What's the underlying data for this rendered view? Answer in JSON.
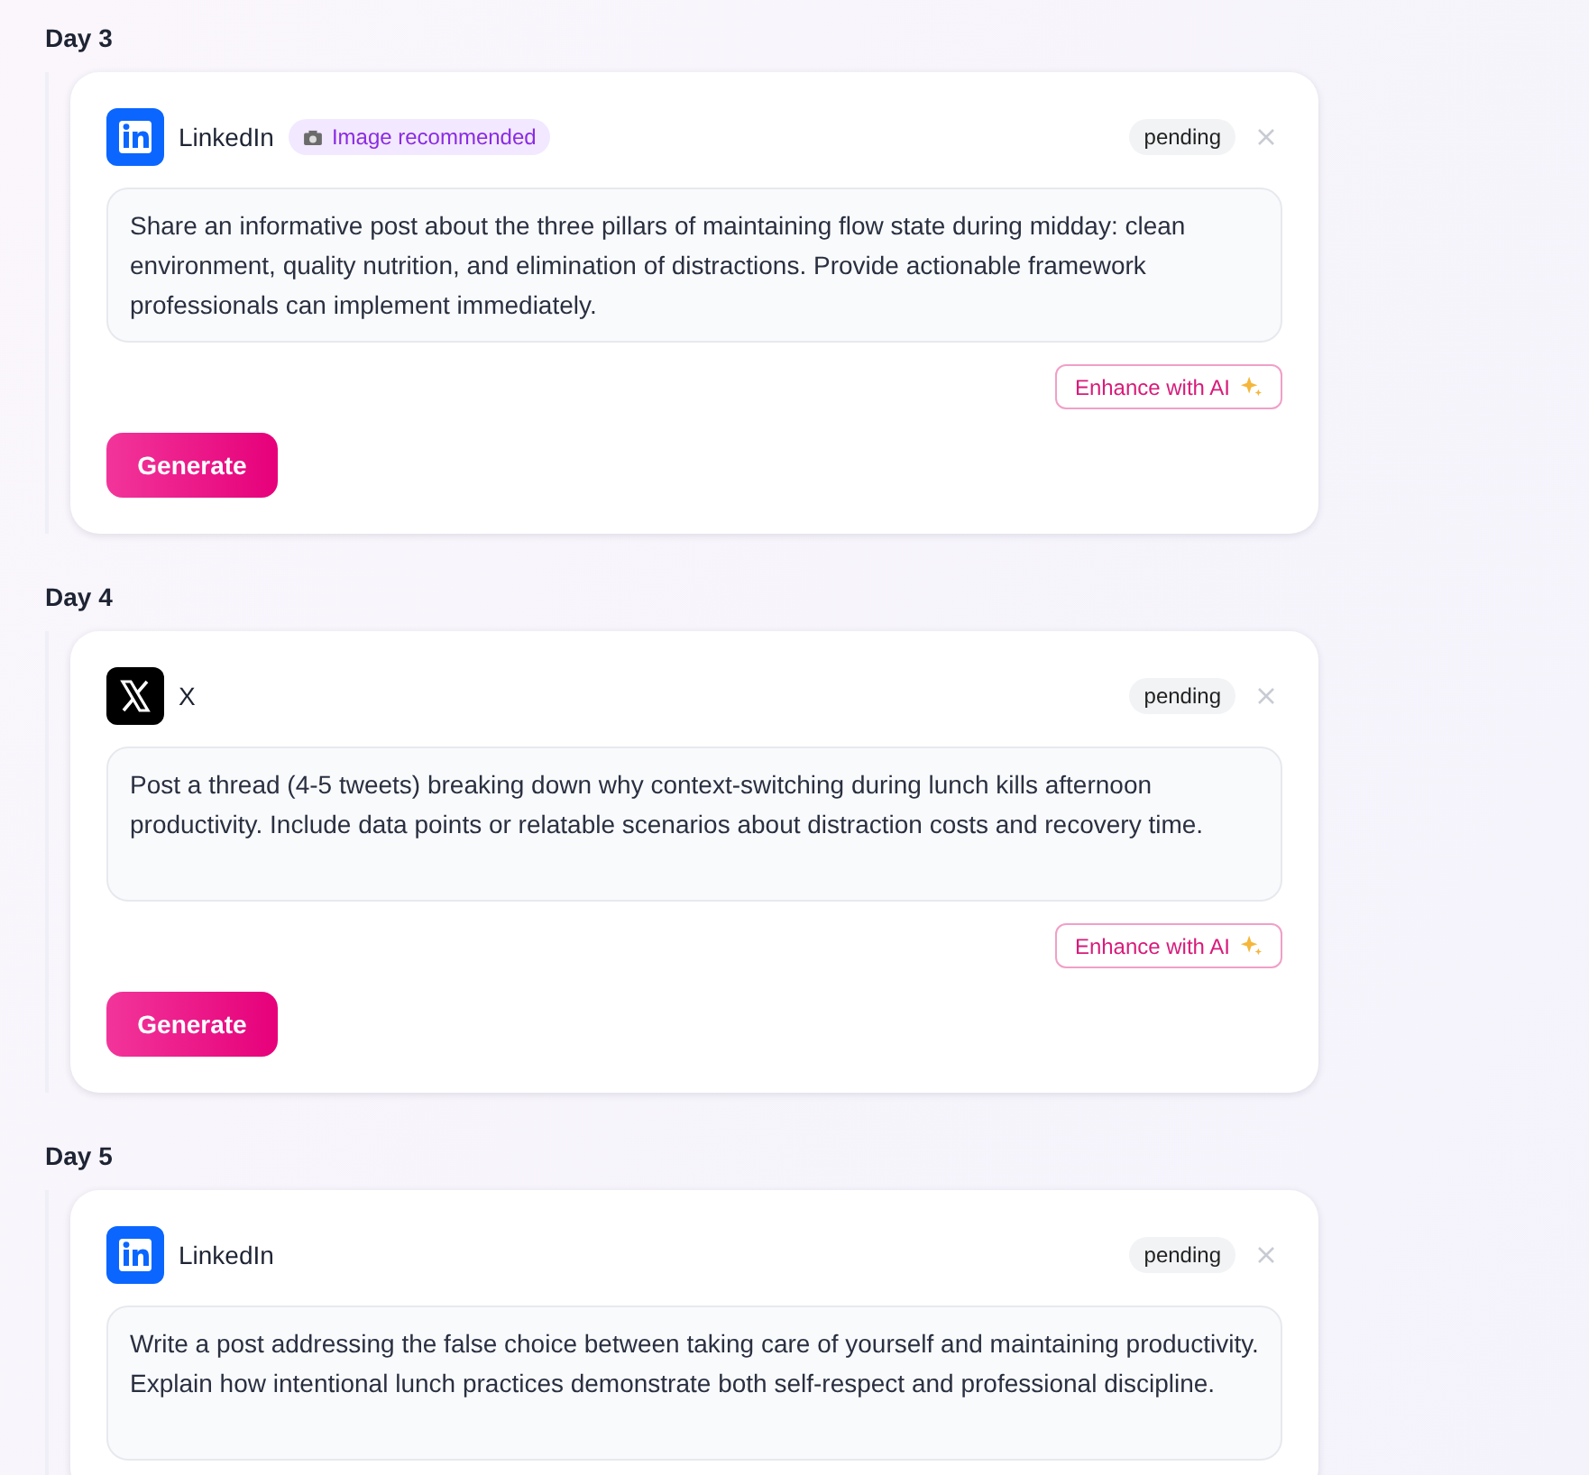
{
  "days": [
    {
      "label": "Day 3",
      "platform": {
        "kind": "linkedin",
        "name": "LinkedIn"
      },
      "badge": "Image recommended",
      "status": "pending",
      "prompt": "Share an informative post about the three pillars of maintaining flow state during midday: clean environment, quality nutrition, and elimination of distractions. Provide actionable framework professionals can implement immediately.",
      "enhance_label": "Enhance with AI",
      "generate_label": "Generate"
    },
    {
      "label": "Day 4",
      "platform": {
        "kind": "x",
        "name": "X"
      },
      "status": "pending",
      "prompt": "Post a thread (4-5 tweets) breaking down why context-switching during lunch kills afternoon productivity. Include data points or relatable scenarios about distraction costs and recovery time.",
      "enhance_label": "Enhance with AI",
      "generate_label": "Generate"
    },
    {
      "label": "Day 5",
      "platform": {
        "kind": "linkedin",
        "name": "LinkedIn"
      },
      "status": "pending",
      "prompt": "Write a post addressing the false choice between taking care of yourself and maintaining productivity. Explain how intentional lunch practices demonstrate both self-respect and professional discipline."
    }
  ]
}
